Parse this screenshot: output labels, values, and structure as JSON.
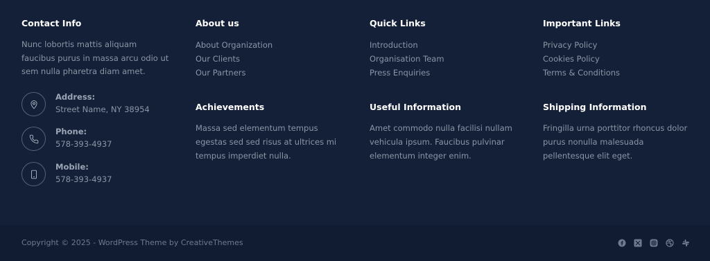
{
  "contact": {
    "title": "Contact Info",
    "description": "Nunc lobortis mattis aliquam faucibus purus in massa arcu odio ut sem nulla pharetra diam amet.",
    "items": [
      {
        "label": "Address:",
        "value": "Street Name, NY 38954",
        "icon": "map-pin-icon"
      },
      {
        "label": "Phone:",
        "value": "578-393-4937",
        "icon": "phone-icon"
      },
      {
        "label": "Mobile:",
        "value": "578-393-4937",
        "icon": "mobile-icon"
      }
    ]
  },
  "about": {
    "title": "About us",
    "links": [
      "About Organization",
      "Our Clients",
      "Our Partners"
    ]
  },
  "quick_links": {
    "title": "Quick Links",
    "links": [
      "Introduction",
      "Organisation Team",
      "Press Enquiries"
    ]
  },
  "important_links": {
    "title": "Important Links",
    "links": [
      "Privacy Policy",
      "Cookies Policy",
      "Terms & Conditions"
    ]
  },
  "achievements": {
    "title": "Achievements",
    "text": "Massa sed elementum tempus egestas sed sed risus at ultrices mi tempus imperdiet nulla."
  },
  "useful_info": {
    "title": "Useful Information",
    "text": "Amet commodo nulla facilisi nullam vehicula ipsum. Faucibus pulvinar elementum integer enim."
  },
  "shipping_info": {
    "title": "Shipping Information",
    "text": "Fringilla urna porttitor rhoncus dolor purus nonulla malesuada pellentesque elit eget."
  },
  "bottom": {
    "copyright": "Copyright © 2025 - WordPress Theme by CreativeThemes",
    "socials": [
      "facebook-icon",
      "x-icon",
      "instagram-icon",
      "dribbble-icon",
      "slack-icon"
    ]
  },
  "colors": {
    "background": "#142038",
    "bottom_bar": "#111b31",
    "heading": "#ffffff",
    "text": "#8b95a6"
  }
}
